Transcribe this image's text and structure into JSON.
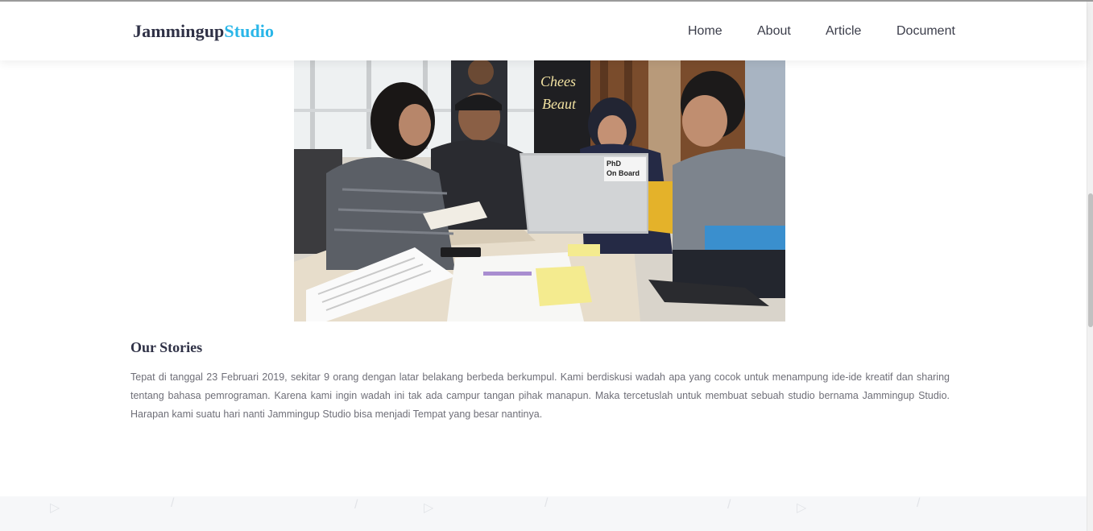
{
  "header": {
    "brand_part1": "Jammingup",
    "brand_part2": "Studio",
    "nav": [
      {
        "label": "Home"
      },
      {
        "label": "About"
      },
      {
        "label": "Article"
      },
      {
        "label": "Document"
      }
    ]
  },
  "colors": {
    "brand_dark": "#2f3146",
    "brand_accent": "#2ab6e8",
    "body_text": "#6f6f78",
    "footer_band": "#f6f7f9"
  },
  "photo": {
    "laptop_sticker": "PhD On Board"
  },
  "stories": {
    "title": "Our Stories",
    "body": "Tepat di tanggal 23 Februari 2019, sekitar 9 orang dengan latar belakang berbeda berkumpul. Kami berdiskusi wadah apa yang cocok untuk menampung ide-ide kreatif dan sharing tentang bahasa pemrograman. Karena kami ingin wadah ini tak ada campur tangan pihak manapun. Maka tercetuslah untuk membuat sebuah studio bernama Jammingup Studio. Harapan kami suatu hari nanti Jammingup Studio bisa menjadi Tempat yang besar nantinya."
  },
  "footer": {
    "decor_icons": [
      "triangle-icon",
      "slash-icon"
    ]
  }
}
